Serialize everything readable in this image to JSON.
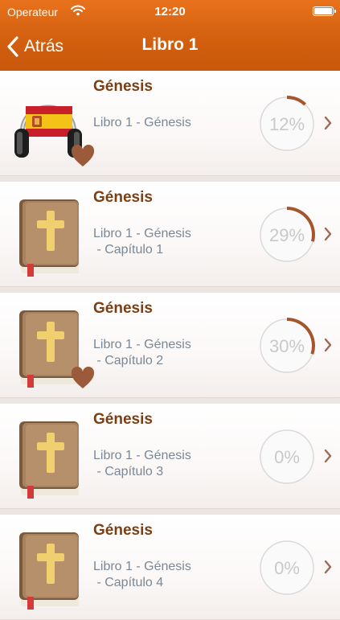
{
  "status_bar": {
    "carrier": "Operateur",
    "time": "12:20"
  },
  "nav": {
    "back_label": "Atrás",
    "title": "Libro 1"
  },
  "colors": {
    "accent": "#d9621a",
    "title_brown": "#7b3f13",
    "heart": "#9b5a3a",
    "progress_arc": "#a5552c"
  },
  "items": [
    {
      "title": "Génesis",
      "subtitle": "Libro 1 - Génesis",
      "progress": 12,
      "progress_label": "12%",
      "icon": "headphones-spain-flag-icon",
      "favorite": true
    },
    {
      "title": "Génesis",
      "subtitle": "Libro 1 - Génesis\n - Capítulo 1",
      "progress": 29,
      "progress_label": "29%",
      "icon": "bible-book-icon",
      "favorite": false
    },
    {
      "title": "Génesis",
      "subtitle": "Libro 1 - Génesis\n - Capítulo 2",
      "progress": 30,
      "progress_label": "30%",
      "icon": "bible-book-icon",
      "favorite": true
    },
    {
      "title": "Génesis",
      "subtitle": "Libro 1 - Génesis\n - Capítulo 3",
      "progress": 0,
      "progress_label": "0%",
      "icon": "bible-book-icon",
      "favorite": false
    },
    {
      "title": "Génesis",
      "subtitle": "Libro 1 - Génesis\n - Capítulo 4",
      "progress": 0,
      "progress_label": "0%",
      "icon": "bible-book-icon",
      "favorite": false
    }
  ]
}
